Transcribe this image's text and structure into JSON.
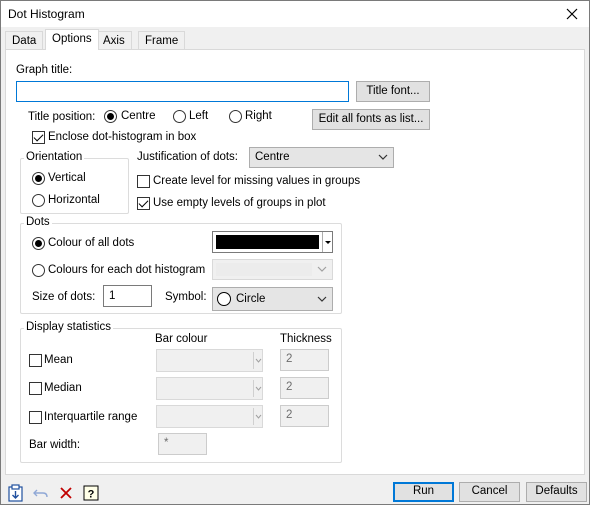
{
  "window": {
    "title": "Dot Histogram"
  },
  "tabs": [
    "Data",
    "Options",
    "Axis",
    "Frame"
  ],
  "graph_title": {
    "label": "Graph title:",
    "value": "",
    "font_button": "Title font..."
  },
  "title_position": {
    "label": "Title position:",
    "options": [
      "Centre",
      "Left",
      "Right"
    ],
    "selected": "Centre"
  },
  "edit_fonts_button": "Edit all fonts as list...",
  "enclose_box": {
    "label": "Enclose dot-histogram in box",
    "checked": true
  },
  "orientation": {
    "label": "Orientation",
    "options": [
      "Vertical",
      "Horizontal"
    ],
    "selected": "Vertical"
  },
  "justification": {
    "label": "Justification of dots:",
    "value": "Centre"
  },
  "missing_level": {
    "label": "Create level for missing values in groups",
    "checked": false
  },
  "empty_levels": {
    "label": "Use empty levels of groups in plot",
    "checked": true
  },
  "dots": {
    "label": "Dots",
    "colour_all": "Colour of all dots",
    "colour_each": "Colours for each dot histogram",
    "selected": "Colour of all dots",
    "colour": "#000000",
    "size_label": "Size of dots:",
    "size_value": "1",
    "symbol_label": "Symbol:",
    "symbol_value": "Circle"
  },
  "display_stats": {
    "label": "Display statistics",
    "bar_colour_header": "Bar colour",
    "thickness_header": "Thickness",
    "rows": [
      {
        "label": "Mean",
        "checked": false,
        "thickness": "2"
      },
      {
        "label": "Median",
        "checked": false,
        "thickness": "2"
      },
      {
        "label": "Interquartile range",
        "checked": false,
        "thickness": "2"
      }
    ],
    "bar_width_label": "Bar width:",
    "bar_width_value": "*"
  },
  "buttons": {
    "run": "Run",
    "cancel": "Cancel",
    "defaults": "Defaults"
  },
  "toolbar_icons": [
    "paste-icon",
    "undo-icon",
    "clear-icon",
    "help-icon"
  ],
  "colors": {
    "accent": "#0078d7",
    "disabled_text": "#6d6d6d"
  }
}
